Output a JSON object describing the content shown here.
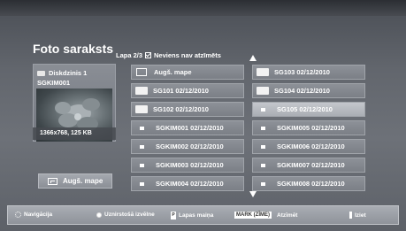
{
  "title": "Foto saraksts",
  "pagination": {
    "page": "Lapa 2/3",
    "mark_status": "Neviens nav atzīmēts"
  },
  "device": {
    "name": "Diskdzinis 1",
    "folder": "SGKIM001",
    "info": "1366x768, 125 KB"
  },
  "up_button_label": "Augš. mape",
  "grid": {
    "left": [
      {
        "label": "Augš. mape",
        "icon": "up-folder-icon"
      },
      {
        "label": "SG101 02/12/2010",
        "icon": "folder-icon"
      },
      {
        "label": "SG102 02/12/2010",
        "icon": "folder-icon"
      },
      {
        "label": "SGKIM001 02/12/2010",
        "icon": "photo-icon"
      },
      {
        "label": "SGKIM002 02/12/2010",
        "icon": "photo-icon"
      },
      {
        "label": "SGKIM003 02/12/2010",
        "icon": "photo-icon"
      },
      {
        "label": "SGKIM004 02/12/2010",
        "icon": "photo-icon"
      }
    ],
    "right": [
      {
        "label": "SG103 02/12/2010",
        "icon": "folder-icon"
      },
      {
        "label": "SG104 02/12/2010",
        "icon": "folder-icon"
      },
      {
        "label": "SG105 02/12/2010",
        "icon": "photo-icon",
        "selected": true
      },
      {
        "label": "SGKIM005 02/12/2010",
        "icon": "photo-icon"
      },
      {
        "label": "SGKIM006 02/12/2010",
        "icon": "photo-icon"
      },
      {
        "label": "SGKIM007 02/12/2010",
        "icon": "photo-icon"
      },
      {
        "label": "SGKIM008 02/12/2010",
        "icon": "photo-icon"
      }
    ]
  },
  "footer": {
    "nav": "Navigācija",
    "menu": "Uznirstošā izvēlne",
    "page": "Lapas maiņa",
    "page_key": "P",
    "mark_key": "MARK (ZĪME)",
    "mark": "Atzīmēt",
    "exit": "Iziet"
  }
}
